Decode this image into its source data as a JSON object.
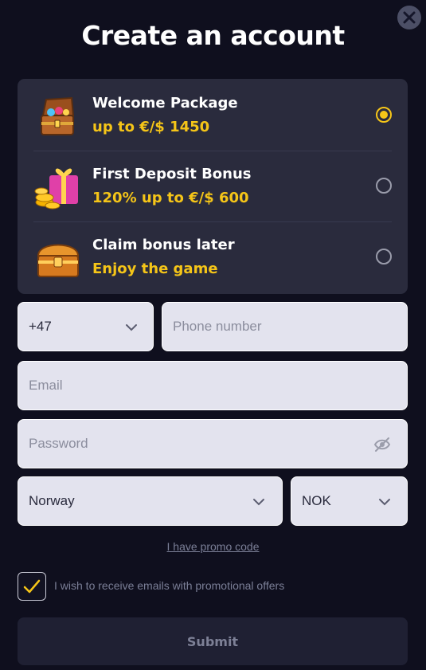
{
  "header": {
    "title": "Create an account",
    "close_icon": "close-icon"
  },
  "bonuses": [
    {
      "title": "Welcome Package",
      "subtitle": "up to €/$ 1450",
      "icon": "treasure-chest-gems-icon",
      "selected": true
    },
    {
      "title": "First Deposit Bonus",
      "subtitle": "120% up to €/$ 600",
      "icon": "gift-box-coins-icon",
      "selected": false
    },
    {
      "title": "Claim bonus later",
      "subtitle": "Enjoy the game",
      "icon": "treasure-chest-icon",
      "selected": false
    }
  ],
  "form": {
    "phone_code": "+47",
    "phone_placeholder": "Phone number",
    "email_placeholder": "Email",
    "password_placeholder": "Password",
    "password_toggle_icon": "eye-off-icon",
    "country": "Norway",
    "currency": "NOK",
    "promo_link": "I have promo code",
    "consent_label": "I wish to receive emails with promotional offers",
    "consent_checked": true,
    "submit_label": "Submit"
  },
  "colors": {
    "background": "#0f0f1e",
    "panel": "#2a2b3d",
    "accent_yellow": "#f5c518",
    "field_bg": "#e3e3ee"
  }
}
